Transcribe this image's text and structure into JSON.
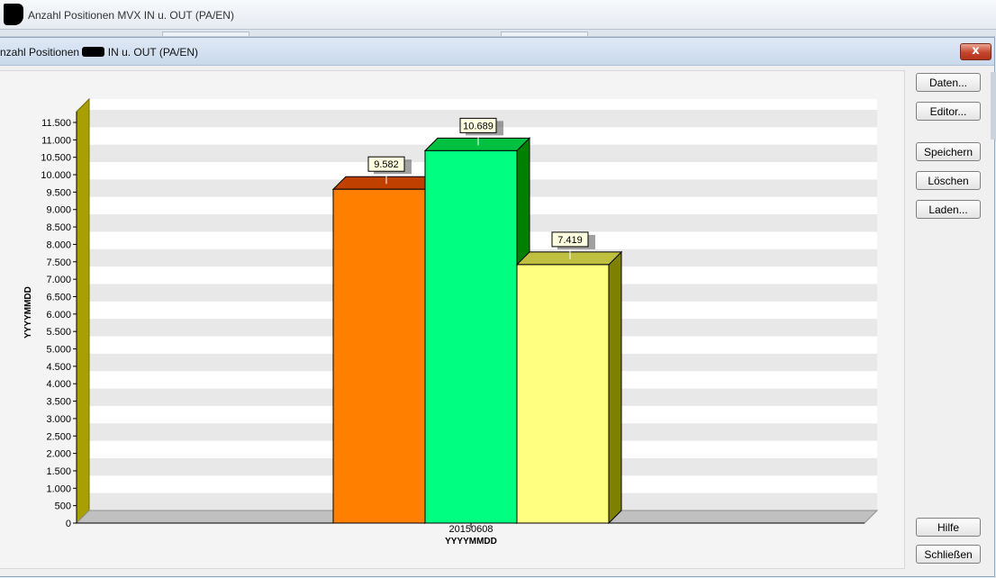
{
  "outer_window": {
    "title": "Anzahl Positionen MVX IN u. OUT (PA/EN)"
  },
  "dialog": {
    "title_prefix": "nzahl Positionen",
    "title_suffix": "IN u. OUT (PA/EN)",
    "close_symbol": "x"
  },
  "buttons": {
    "daten": "Daten...",
    "editor": "Editor...",
    "speichern": "Speichern",
    "loeschen": "Löschen",
    "laden": "Laden...",
    "hilfe": "Hilfe",
    "schliessen": "Schließen"
  },
  "chart_data": {
    "type": "bar",
    "categories": [
      "20150608"
    ],
    "series": [
      {
        "values": [
          9582
        ],
        "face_color": "#ff8000",
        "top_color": "#c04000",
        "side_color": "#8a3000"
      },
      {
        "values": [
          10689
        ],
        "face_color": "#00ff80",
        "top_color": "#00c040",
        "side_color": "#008000"
      },
      {
        "values": [
          7419
        ],
        "face_color": "#ffff80",
        "top_color": "#c0c040",
        "side_color": "#808000"
      }
    ],
    "data_labels": [
      "9.582",
      "10.689",
      "7.419"
    ],
    "xlabel": "YYYYMMDD",
    "ylabel": "YYYYMMDD",
    "ylim": [
      0,
      11500
    ],
    "yticks": [
      "0",
      "500",
      "1.000",
      "1.500",
      "2.000",
      "2.500",
      "3.000",
      "3.500",
      "4.000",
      "4.500",
      "5.000",
      "5.500",
      "6.000",
      "6.500",
      "7.000",
      "7.500",
      "8.000",
      "8.500",
      "9.000",
      "9.500",
      "10.000",
      "10.500",
      "11.000",
      "11.500"
    ],
    "ytick_values": [
      0,
      500,
      1000,
      1500,
      2000,
      2500,
      3000,
      3500,
      4000,
      4500,
      5000,
      5500,
      6000,
      6500,
      7000,
      7500,
      8000,
      8500,
      9000,
      9500,
      10000,
      10500,
      11000,
      11500
    ],
    "grid": true,
    "legend": "none",
    "colors": {
      "left_wall": "#a8a000",
      "floor": "#c0c0c0",
      "stripe": "#e8e8e8",
      "background": "#ffffff"
    }
  }
}
